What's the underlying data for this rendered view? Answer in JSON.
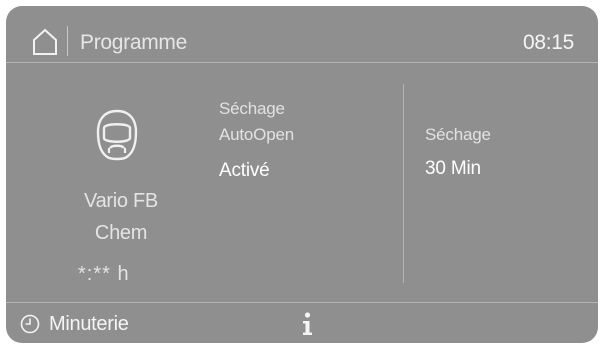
{
  "header": {
    "home_icon": "home-icon",
    "title": "Programme",
    "time": "08:15"
  },
  "program": {
    "icon": "face-mask-icon",
    "name_line1": "Vario FB",
    "name_line2": "Chem",
    "remaining_time": "*:** h"
  },
  "option": {
    "label_line1": "Séchage",
    "label_line2": "AutoOpen",
    "value": "Activé"
  },
  "drying": {
    "label": "Séchage",
    "value": "30 Min"
  },
  "footer": {
    "timer_icon": "clock-icon",
    "timer_label": "Minuterie",
    "info_icon": "info-icon"
  },
  "colors": {
    "panel_background": "#8f8f8f",
    "text": "#f2f2f2",
    "divider": "#b4b4b4"
  }
}
